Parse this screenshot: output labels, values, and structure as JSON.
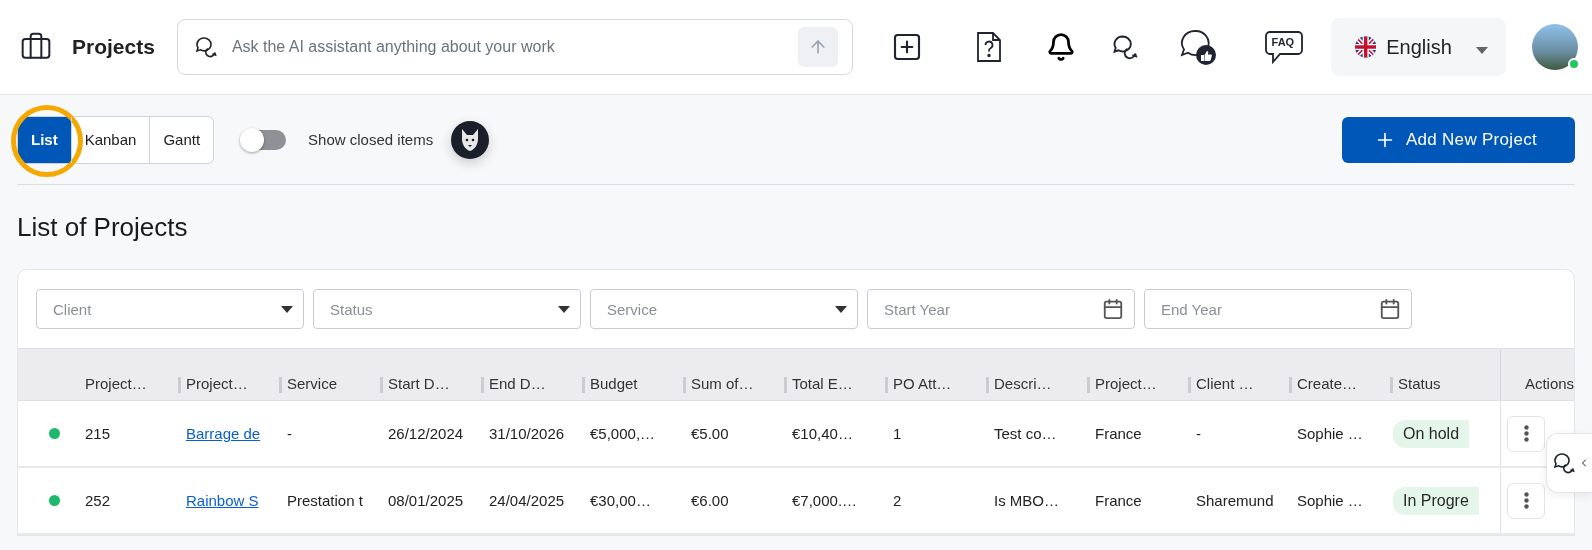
{
  "header": {
    "title": "Projects",
    "search": {
      "placeholder": "Ask the AI assistant anything about your work"
    },
    "faq_label": "FAQ",
    "language": "English",
    "user": {
      "online": true
    }
  },
  "toolbar": {
    "views": [
      {
        "label": "List",
        "selected": true,
        "highlighted": true
      },
      {
        "label": "Kanban",
        "selected": false,
        "highlighted": false
      },
      {
        "label": "Gantt",
        "selected": false,
        "highlighted": false
      }
    ],
    "closed_toggle": {
      "label": "Show closed items",
      "on": false
    },
    "add_button": "Add New Project"
  },
  "page_title": "List of Projects",
  "filters": [
    {
      "kind": "select",
      "placeholder": "Client"
    },
    {
      "kind": "select",
      "placeholder": "Status"
    },
    {
      "kind": "select",
      "placeholder": "Service"
    },
    {
      "kind": "date",
      "placeholder": "Start Year"
    },
    {
      "kind": "date",
      "placeholder": "End Year"
    }
  ],
  "table": {
    "columns": [
      {
        "label": "Project…",
        "kind": "text"
      },
      {
        "label": "Project…",
        "kind": "link"
      },
      {
        "label": "Service",
        "kind": "text"
      },
      {
        "label": "Start D…",
        "kind": "text"
      },
      {
        "label": "End D…",
        "kind": "text"
      },
      {
        "label": "Budget",
        "kind": "text"
      },
      {
        "label": "Sum of…",
        "kind": "text"
      },
      {
        "label": "Total E…",
        "kind": "text"
      },
      {
        "label": "PO Att…",
        "kind": "text"
      },
      {
        "label": "Descri…",
        "kind": "text"
      },
      {
        "label": "Project…",
        "kind": "text"
      },
      {
        "label": "Client …",
        "kind": "text"
      },
      {
        "label": "Create…",
        "kind": "text"
      },
      {
        "label": "Status",
        "kind": "status"
      }
    ],
    "actions_label": "Actions",
    "rows": [
      {
        "color": "#1db86a",
        "cells": [
          "215",
          "Barrage de",
          "-",
          "26/12/2024",
          "31/10/2026",
          "€5,000,…",
          "€5.00",
          "€10,40…",
          "1",
          "Test co…",
          "France",
          "-",
          "Sophie …",
          "On hold"
        ]
      },
      {
        "color": "#1db86a",
        "cells": [
          "252",
          "Rainbow S",
          "Prestation t",
          "08/01/2025",
          "24/04/2025",
          "€30,00…",
          "€6.00",
          "€7,000.…",
          "2",
          "Is MBO…",
          "France",
          "Sharemund",
          "Sophie …",
          "In Progre"
        ]
      }
    ]
  }
}
